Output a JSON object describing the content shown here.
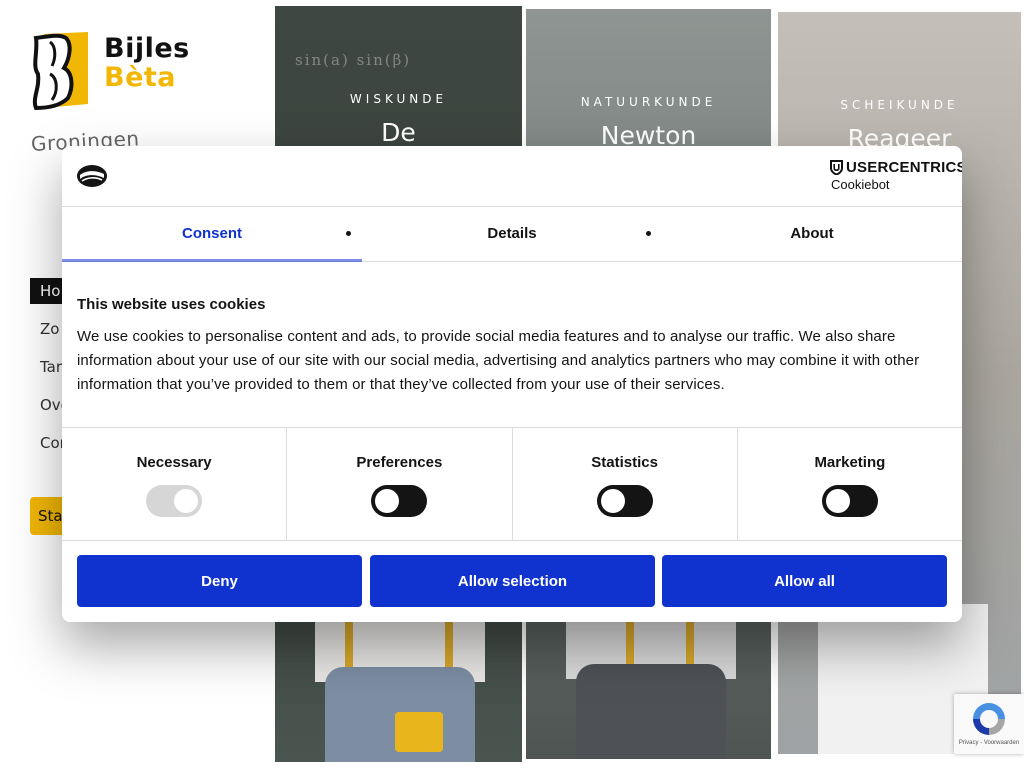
{
  "site": {
    "logo": {
      "line1": "Bijles",
      "line2": "Bèta"
    },
    "city": "Groningen",
    "menu": [
      "Ho",
      "Zo",
      "Tar",
      "Ove",
      "Con"
    ],
    "start_button": "Sta",
    "cards": [
      {
        "label": "WISKUNDE",
        "title": "De",
        "chalk": "sin(a) sin(β)"
      },
      {
        "label": "NATUURKUNDE",
        "title": "Newton"
      },
      {
        "label": "SCHEIKUNDE",
        "title": "Reageer"
      }
    ]
  },
  "dialog": {
    "brand": "USERCENTRICS",
    "brand_sub": "Cookiebot",
    "tabs": [
      "Consent",
      "Details",
      "About"
    ],
    "active_tab": "Consent",
    "heading": "This website uses cookies",
    "body": "We use cookies to personalise content and ads, to provide social media features and to analyse our traffic. We also share information about your use of our site with our social media, advertising and analytics partners who may combine it with other information that you’ve provided to them or that they’ve collected from your use of their services.",
    "toggles": [
      {
        "label": "Necessary",
        "checked": true,
        "disabled": true
      },
      {
        "label": "Preferences",
        "checked": false,
        "disabled": false
      },
      {
        "label": "Statistics",
        "checked": false,
        "disabled": false
      },
      {
        "label": "Marketing",
        "checked": false,
        "disabled": false
      }
    ],
    "buttons": {
      "deny": "Deny",
      "allow_selection": "Allow selection",
      "allow_all": "Allow all"
    },
    "accent_color": "#1032cf"
  },
  "recaptcha": {
    "footer": "Privacy - Voorwaarden"
  }
}
